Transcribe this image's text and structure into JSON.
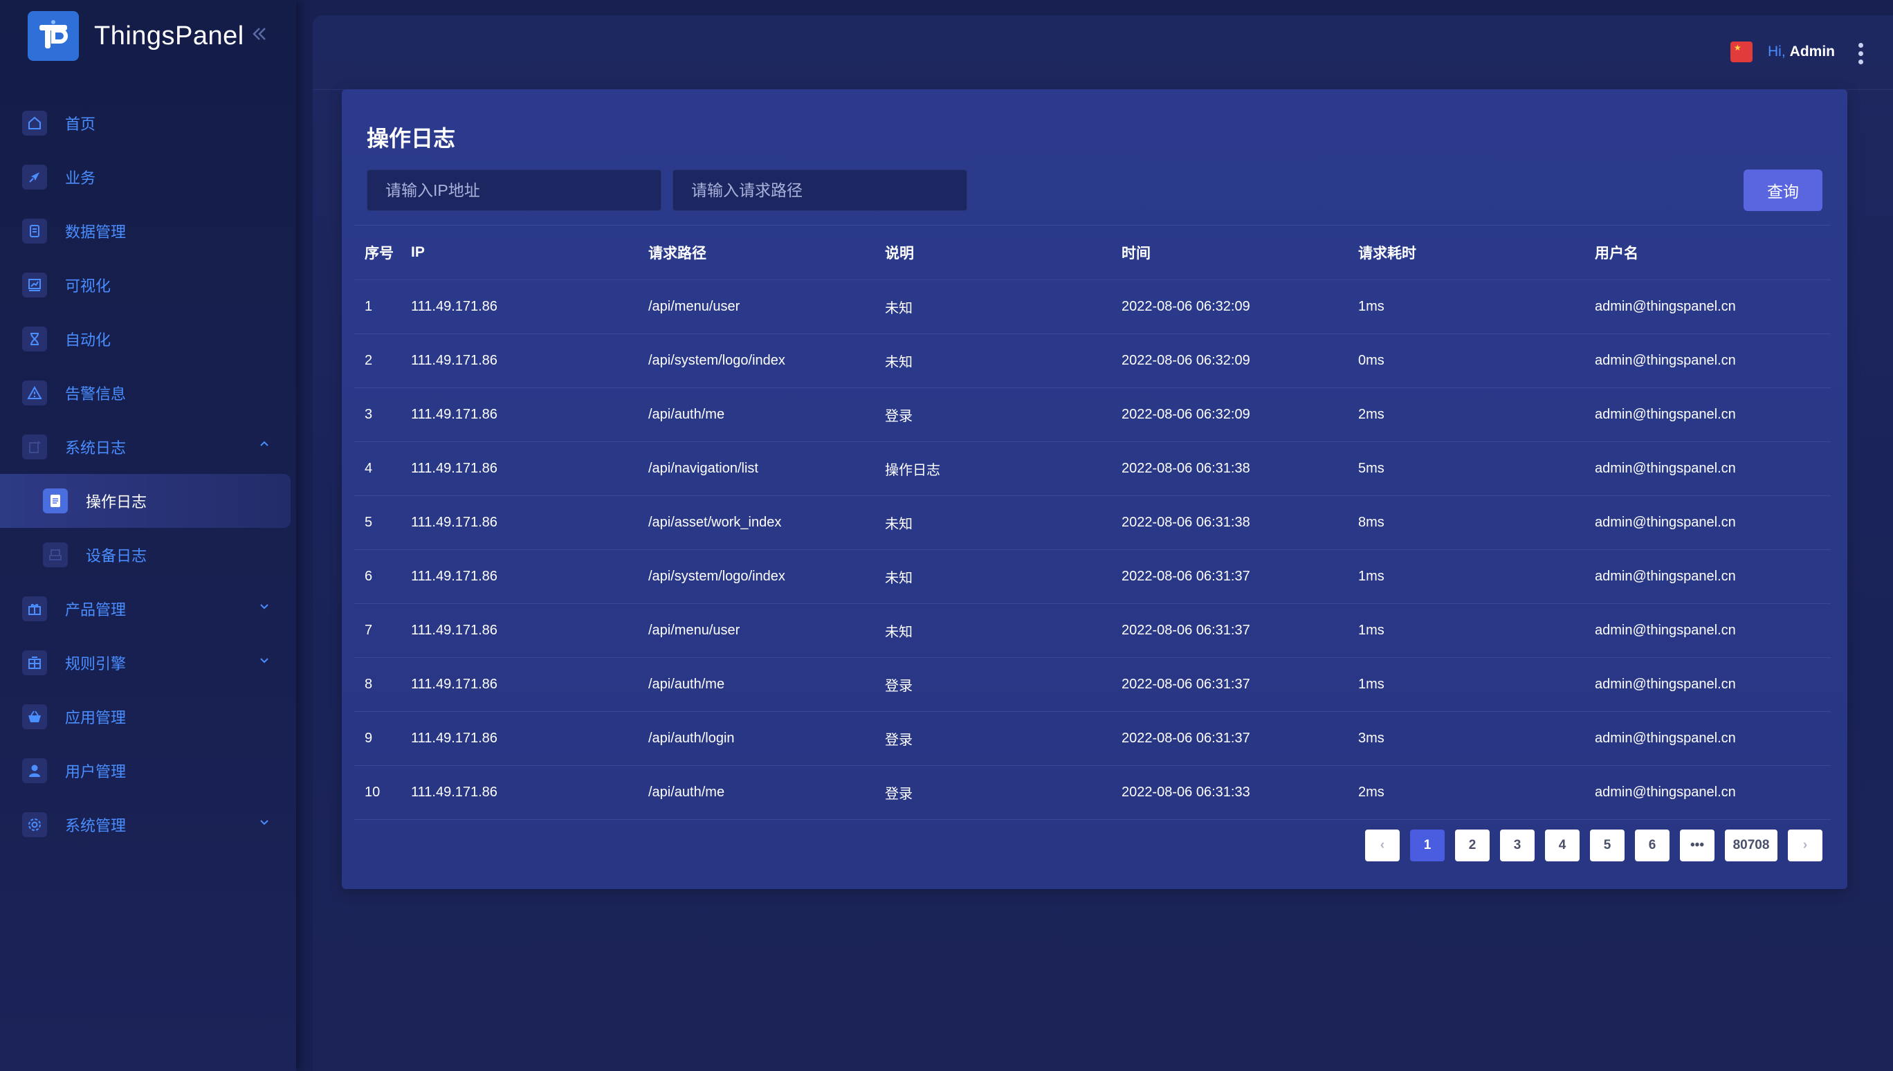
{
  "app": {
    "name": "ThingsPanel"
  },
  "sidebar": {
    "items": [
      {
        "label": "首页",
        "icon": "home-icon"
      },
      {
        "label": "业务",
        "icon": "compass-icon"
      },
      {
        "label": "数据管理",
        "icon": "database-icon"
      },
      {
        "label": "可视化",
        "icon": "chart-icon"
      },
      {
        "label": "自动化",
        "icon": "hourglass-icon"
      },
      {
        "label": "告警信息",
        "icon": "warning-icon"
      },
      {
        "label": "系统日志",
        "icon": "log-icon",
        "expanded": true
      },
      {
        "label": "操作日志",
        "icon": "document-icon",
        "active": true
      },
      {
        "label": "设备日志",
        "icon": "device-log-icon"
      },
      {
        "label": "产品管理",
        "icon": "gift-icon"
      },
      {
        "label": "规则引擎",
        "icon": "rule-icon"
      },
      {
        "label": "应用管理",
        "icon": "basket-icon"
      },
      {
        "label": "用户管理",
        "icon": "user-icon"
      },
      {
        "label": "系统管理",
        "icon": "gear-icon"
      }
    ]
  },
  "header": {
    "hi": "Hi,",
    "user": "Admin"
  },
  "page": {
    "title": "操作日志",
    "ip_placeholder": "请输入IP地址",
    "path_placeholder": "请输入请求路径",
    "query_label": "查询"
  },
  "table": {
    "columns": [
      "序号",
      "IP",
      "请求路径",
      "说明",
      "时间",
      "请求耗时",
      "用户名"
    ],
    "rows": [
      [
        "1",
        "111.49.171.86",
        "/api/menu/user",
        "未知",
        "2022-08-06 06:32:09",
        "1ms",
        "admin@thingspanel.cn"
      ],
      [
        "2",
        "111.49.171.86",
        "/api/system/logo/index",
        "未知",
        "2022-08-06 06:32:09",
        "0ms",
        "admin@thingspanel.cn"
      ],
      [
        "3",
        "111.49.171.86",
        "/api/auth/me",
        "登录",
        "2022-08-06 06:32:09",
        "2ms",
        "admin@thingspanel.cn"
      ],
      [
        "4",
        "111.49.171.86",
        "/api/navigation/list",
        "操作日志",
        "2022-08-06 06:31:38",
        "5ms",
        "admin@thingspanel.cn"
      ],
      [
        "5",
        "111.49.171.86",
        "/api/asset/work_index",
        "未知",
        "2022-08-06 06:31:38",
        "8ms",
        "admin@thingspanel.cn"
      ],
      [
        "6",
        "111.49.171.86",
        "/api/system/logo/index",
        "未知",
        "2022-08-06 06:31:37",
        "1ms",
        "admin@thingspanel.cn"
      ],
      [
        "7",
        "111.49.171.86",
        "/api/menu/user",
        "未知",
        "2022-08-06 06:31:37",
        "1ms",
        "admin@thingspanel.cn"
      ],
      [
        "8",
        "111.49.171.86",
        "/api/auth/me",
        "登录",
        "2022-08-06 06:31:37",
        "1ms",
        "admin@thingspanel.cn"
      ],
      [
        "9",
        "111.49.171.86",
        "/api/auth/login",
        "登录",
        "2022-08-06 06:31:37",
        "3ms",
        "admin@thingspanel.cn"
      ],
      [
        "10",
        "111.49.171.86",
        "/api/auth/me",
        "登录",
        "2022-08-06 06:31:33",
        "2ms",
        "admin@thingspanel.cn"
      ]
    ]
  },
  "pagination": {
    "prev": "‹",
    "pages": [
      "1",
      "2",
      "3",
      "4",
      "5",
      "6",
      "•••",
      "80708"
    ],
    "current": "1",
    "next": "›"
  },
  "colors": {
    "accent": "#4a8eff",
    "button": "#5a66e0",
    "card": "#2b3a8c",
    "sidebar": "#141c48"
  }
}
